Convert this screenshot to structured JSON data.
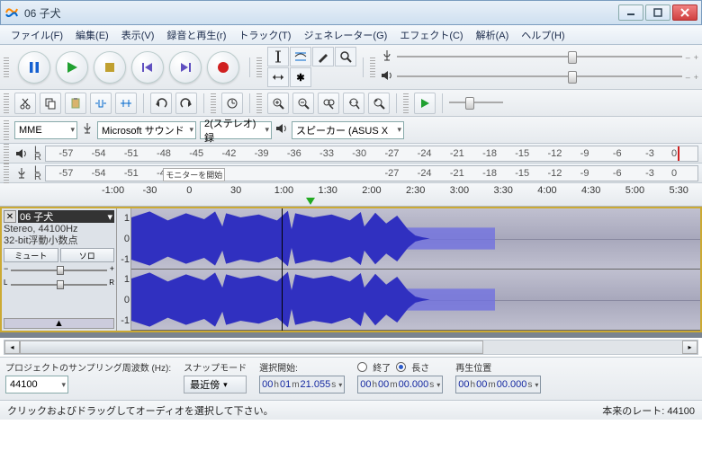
{
  "window": {
    "title": "06 子犬"
  },
  "menu": {
    "file": "ファイル(F)",
    "edit": "編集(E)",
    "view": "表示(V)",
    "transport": "録音と再生(r)",
    "tracks": "トラック(T)",
    "generate": "ジェネレーター(G)",
    "effect": "エフェクト(C)",
    "analyze": "解析(A)",
    "help": "ヘルプ(H)"
  },
  "device": {
    "host": "MME",
    "recording": "Microsoft サウンド",
    "channels": "2(ステレオ)録",
    "playback": "スピーカー (ASUS X"
  },
  "meters": {
    "rec_overlay": "モニターを開始",
    "ticks": [
      "-57",
      "-54",
      "-51",
      "-48",
      "-45",
      "-42",
      "-39",
      "-36",
      "-33",
      "-30",
      "-27",
      "-24",
      "-21",
      "-18",
      "-15",
      "-12",
      "-9",
      "-6",
      "-3",
      "0"
    ]
  },
  "ruler": {
    "labels": [
      "-1:00",
      "-30",
      "0",
      "30",
      "1:00",
      "1:30",
      "2:00",
      "2:30",
      "3:00",
      "3:30",
      "4:00",
      "4:30",
      "5:00",
      "5:30"
    ],
    "playhead_label": "1:30"
  },
  "track": {
    "name": "06 子犬",
    "format_line1": "Stereo, 44100Hz",
    "format_line2": "32-bit浮動小数点",
    "mute": "ミュート",
    "solo": "ソロ",
    "yscale": [
      "1",
      "0",
      "-1",
      "1",
      "0",
      "-1"
    ]
  },
  "selection": {
    "rate_label": "プロジェクトのサンプリング周波数 (Hz):",
    "rate_value": "44100",
    "snap_label": "スナップモード",
    "snap_value": "最近傍",
    "start_label": "選択開始:",
    "end_label": "終了",
    "length_label": "長さ",
    "pos_label": "再生位置",
    "start": {
      "h": "00",
      "m": "01",
      "s": "21.055"
    },
    "length": {
      "h": "00",
      "m": "00",
      "s": "00.000"
    },
    "pos": {
      "h": "00",
      "m": "00",
      "s": "00.000"
    },
    "unit_h": "h",
    "unit_m": "m",
    "unit_s": "s"
  },
  "status": {
    "left": "クリックおよびドラッグしてオーディオを選択して下さい。",
    "right": "本来のレート: 44100"
  }
}
